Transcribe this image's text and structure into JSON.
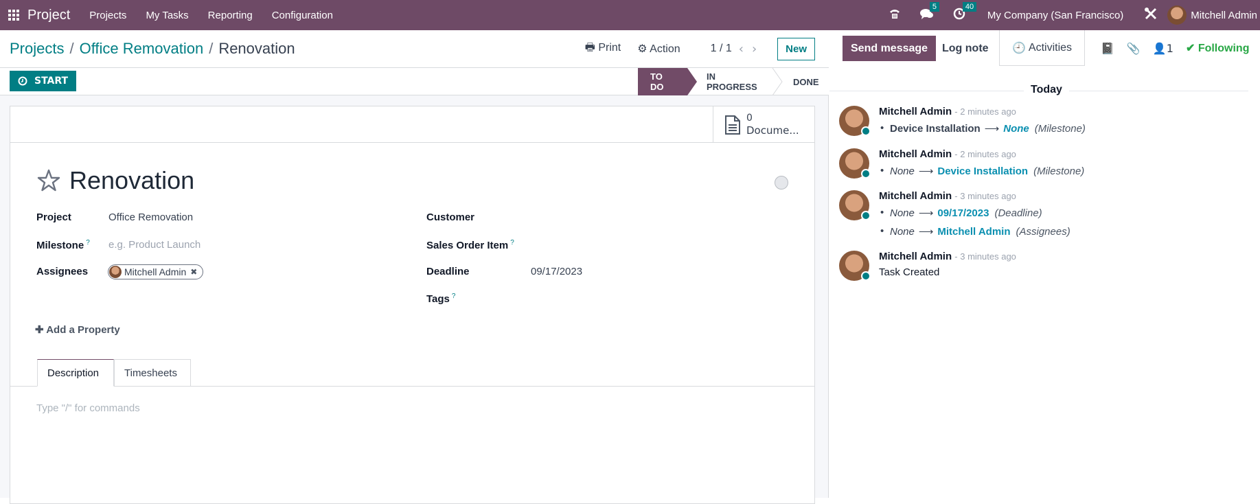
{
  "navbar": {
    "app_name": "Project",
    "menus": [
      "Projects",
      "My Tasks",
      "Reporting",
      "Configuration"
    ],
    "messages_badge": "5",
    "activities_badge": "40",
    "company": "My Company (San Francisco)",
    "user": "Mitchell Admin",
    "icons": [
      "apps-grid-icon",
      "phone-icon",
      "chat-icon",
      "clock-icon",
      "tools-icon",
      "avatar"
    ]
  },
  "breadcrumb": {
    "items": [
      "Projects",
      "Office Removation"
    ],
    "current": "Renovation"
  },
  "toolbar": {
    "print_label": "Print",
    "action_label": "Action",
    "pager": "1 / 1",
    "new_label": "New"
  },
  "statusbar": {
    "start_label": "START",
    "stages": [
      "TO DO",
      "IN PROGRESS",
      "DONE"
    ],
    "active_stage": "TO DO"
  },
  "smart_buttons": {
    "documents_count": "0",
    "documents_label": "Docume..."
  },
  "task": {
    "name": "Renovation",
    "starred": false,
    "fields": {
      "project_label": "Project",
      "project_value": "Office Removation",
      "milestone_label": "Milestone",
      "milestone_placeholder": "e.g. Product Launch",
      "assignees_label": "Assignees",
      "assignee": "Mitchell Admin",
      "customer_label": "Customer",
      "sales_order_item_label": "Sales Order Item",
      "deadline_label": "Deadline",
      "deadline_value": "09/17/2023",
      "tags_label": "Tags",
      "help_mark": "?"
    },
    "add_property_label": "Add a Property",
    "tabs": [
      "Description",
      "Timesheets"
    ],
    "active_tab": "Description",
    "description_placeholder": "Type \"/\" for commands"
  },
  "chatter": {
    "send_message_label": "Send message",
    "log_note_label": "Log note",
    "activities_label": "Activities",
    "followers_count": "1",
    "following_label": "Following",
    "date_separator": "Today",
    "messages": [
      {
        "author": "Mitchell Admin",
        "time": "- 2 minutes ago",
        "changes": [
          {
            "old": "Device Installation",
            "new": "None",
            "field": "(Milestone)"
          }
        ]
      },
      {
        "author": "Mitchell Admin",
        "time": "- 2 minutes ago",
        "changes": [
          {
            "old": "None",
            "new": "Device Installation",
            "field": "(Milestone)"
          }
        ]
      },
      {
        "author": "Mitchell Admin",
        "time": "- 3 minutes ago",
        "changes": [
          {
            "old": "None",
            "new": "09/17/2023",
            "field": "(Deadline)"
          },
          {
            "old": "None",
            "new": "Mitchell Admin",
            "field": "(Assignees)"
          }
        ]
      },
      {
        "author": "Mitchell Admin",
        "time": "- 3 minutes ago",
        "body": "Task Created"
      }
    ]
  },
  "colors": {
    "brand": "#714b67",
    "accent": "#017e84",
    "link": "#0a8fb0",
    "following": "#28a745"
  }
}
